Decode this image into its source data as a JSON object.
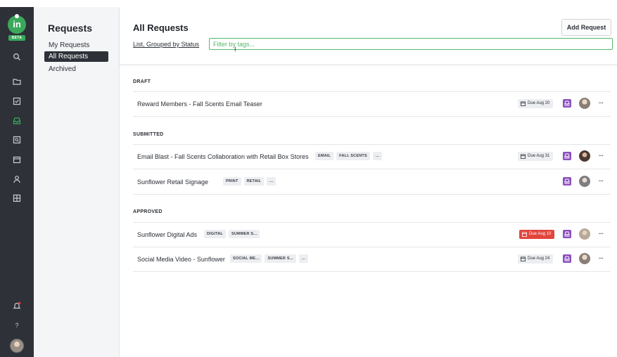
{
  "rail": {
    "logo": "in",
    "beta": "BETA",
    "icons": [
      "search-icon",
      "folder-icon",
      "tasks-icon",
      "inbox-icon",
      "review-icon",
      "calendar-icon",
      "user-icon",
      "layout-icon",
      "bell-icon",
      "help-icon"
    ],
    "help_glyph": "?"
  },
  "sidebar": {
    "title": "Requests",
    "items": [
      {
        "label": "My Requests"
      },
      {
        "label": "All Requests"
      },
      {
        "label": "Archived"
      }
    ]
  },
  "header": {
    "title": "All Requests",
    "view_label": "List, Grouped by Status",
    "filter_placeholder": "Filter by tags...",
    "add_button": "Add Request"
  },
  "sections": [
    {
      "title": "DRAFT",
      "rows": [
        {
          "title": "Reward Members - Fall Scents Email Teaser",
          "tags": [],
          "due": "Due Aug 20",
          "overdue": false
        }
      ]
    },
    {
      "title": "SUBMITTED",
      "rows": [
        {
          "title": "Email Blast - Fall Scents Collaboration with Retail Box Stores",
          "tags": [
            "EMAIL",
            "FALL SCENTS",
            "..."
          ],
          "due": "Due Aug 31",
          "overdue": false
        },
        {
          "title": "Sunflower Retail Signage",
          "tags": [
            "PRINT",
            "RETAIL",
            "..."
          ],
          "due": "",
          "overdue": false
        }
      ]
    },
    {
      "title": "APPROVED",
      "rows": [
        {
          "title": "Sunflower Digital Ads",
          "tags": [
            "DIGITAL",
            "SUMMER S..."
          ],
          "due": "Due Aug 10",
          "overdue": true
        },
        {
          "title": "Social Media Video - Sunflower",
          "tags": [
            "SOCIAL ME...",
            "SUMMER S...",
            "..."
          ],
          "due": "Due Aug 24",
          "overdue": false
        }
      ]
    }
  ],
  "more_label": "···",
  "colors": {
    "accent": "#3aa95b",
    "rail": "#2e3238",
    "badge": "#8b4fbf",
    "overdue": "#e2453c"
  }
}
